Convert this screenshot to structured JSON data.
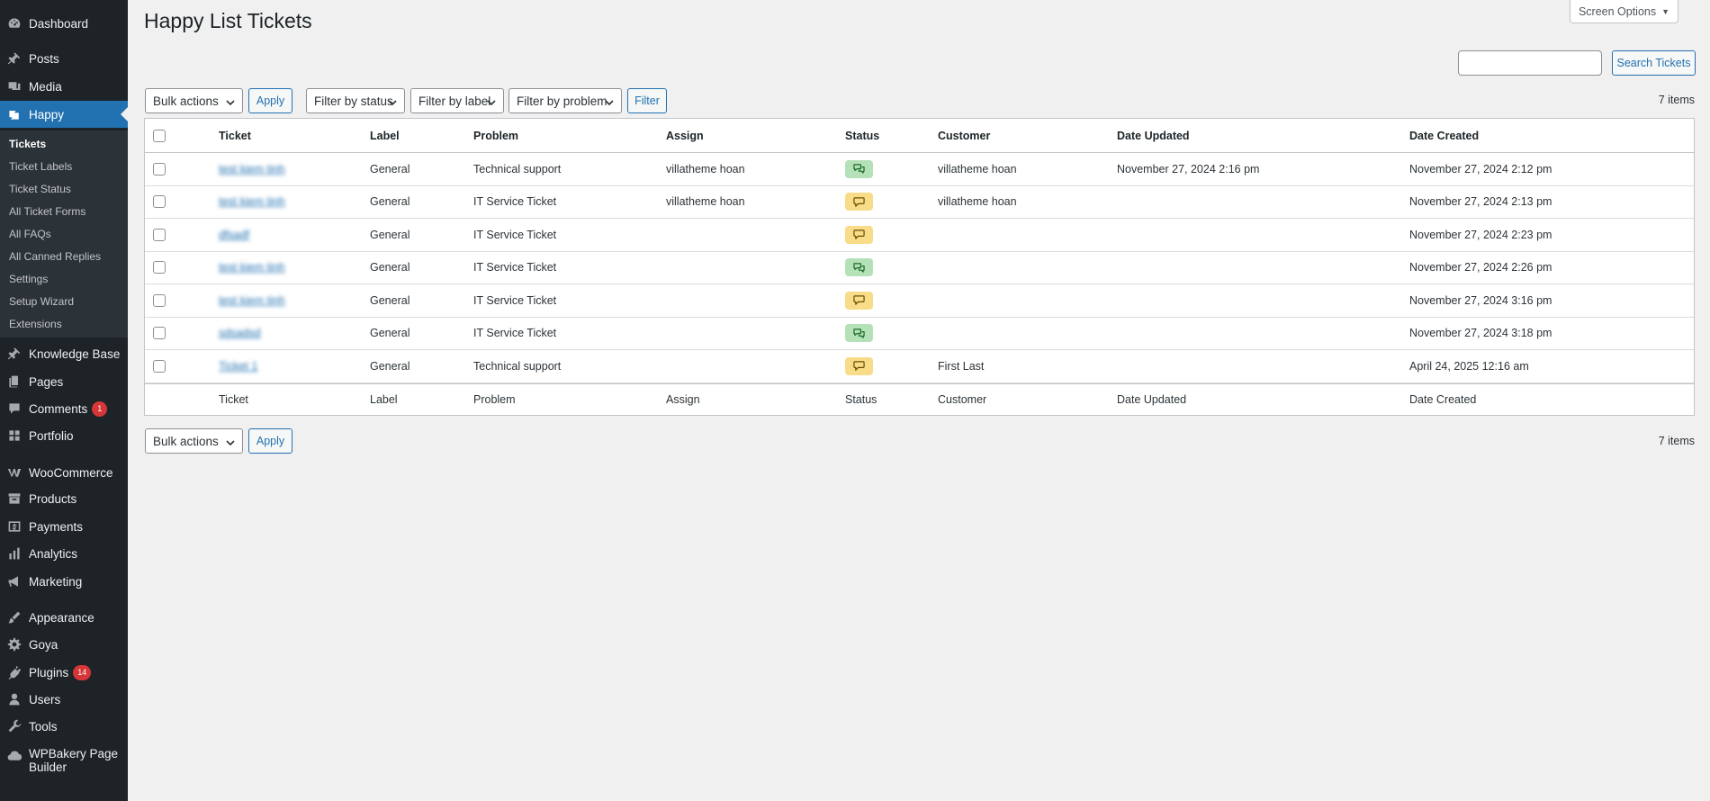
{
  "sidebar": {
    "items": [
      {
        "label": "Dashboard",
        "icon": "dashboard-icon"
      },
      {
        "label": "Posts",
        "icon": "pin-icon"
      },
      {
        "label": "Media",
        "icon": "media-icon"
      },
      {
        "label": "Happy",
        "icon": "happy-icon"
      },
      {
        "label": "Knowledge Base",
        "icon": "pin-icon"
      },
      {
        "label": "Pages",
        "icon": "pages-icon"
      },
      {
        "label": "Comments",
        "icon": "comment-icon",
        "badge": "1"
      },
      {
        "label": "Portfolio",
        "icon": "portfolio-icon"
      },
      {
        "label": "WooCommerce",
        "icon": "woocommerce-icon"
      },
      {
        "label": "Products",
        "icon": "archive-icon"
      },
      {
        "label": "Payments",
        "icon": "dollar-icon"
      },
      {
        "label": "Analytics",
        "icon": "bar-chart-icon"
      },
      {
        "label": "Marketing",
        "icon": "megaphone-icon"
      },
      {
        "label": "Appearance",
        "icon": "brush-icon"
      },
      {
        "label": "Goya",
        "icon": "gear-icon"
      },
      {
        "label": "Plugins",
        "icon": "plugin-icon",
        "badge": "14"
      },
      {
        "label": "Users",
        "icon": "user-icon"
      },
      {
        "label": "Tools",
        "icon": "wrench-icon"
      },
      {
        "label": "WPBakery Page Builder",
        "icon": "cloud-icon"
      }
    ],
    "submenu": [
      "Tickets",
      "Ticket Labels",
      "Ticket Status",
      "All Ticket Forms",
      "All FAQs",
      "All Canned Replies",
      "Settings",
      "Setup Wizard",
      "Extensions"
    ]
  },
  "header": {
    "title": "Happy List Tickets",
    "screen_options": "Screen Options"
  },
  "search": {
    "button": "Search Tickets",
    "value": ""
  },
  "toolbar": {
    "bulk_actions": "Bulk actions",
    "apply": "Apply",
    "filter_status": "Filter by status",
    "filter_label": "Filter by label",
    "filter_problem": "Filter by problem",
    "filter": "Filter",
    "items_count": "7 items"
  },
  "table": {
    "columns": [
      "Ticket",
      "Label",
      "Problem",
      "Assign",
      "Status",
      "Customer",
      "Date Updated",
      "Date Created"
    ],
    "rows": [
      {
        "ticket": "test kiem tinh",
        "label": "General",
        "problem": "Technical support",
        "assign": "villatheme hoan",
        "status": "green",
        "customer": "villatheme hoan",
        "updated": "November 27, 2024 2:16 pm",
        "created": "November 27, 2024 2:12 pm"
      },
      {
        "ticket": "test kiem tinh",
        "label": "General",
        "problem": "IT Service Ticket",
        "assign": "villatheme hoan",
        "status": "yellow",
        "customer": "villatheme hoan",
        "updated": "",
        "created": "November 27, 2024 2:13 pm"
      },
      {
        "ticket": "dfsadf",
        "label": "General",
        "problem": "IT Service Ticket",
        "assign": "",
        "status": "yellow",
        "customer": "",
        "updated": "",
        "created": "November 27, 2024 2:23 pm"
      },
      {
        "ticket": "test kiem tinh",
        "label": "General",
        "problem": "IT Service Ticket",
        "assign": "",
        "status": "green",
        "customer": "",
        "updated": "",
        "created": "November 27, 2024 2:26 pm"
      },
      {
        "ticket": "test kiem tinh",
        "label": "General",
        "problem": "IT Service Ticket",
        "assign": "",
        "status": "yellow",
        "customer": "",
        "updated": "",
        "created": "November 27, 2024 3:16 pm"
      },
      {
        "ticket": "sdsadsd",
        "label": "General",
        "problem": "IT Service Ticket",
        "assign": "",
        "status": "green",
        "customer": "",
        "updated": "",
        "created": "November 27, 2024 3:18 pm"
      },
      {
        "ticket": "Ticket 1",
        "label": "General",
        "problem": "Technical support",
        "assign": "",
        "status": "yellow",
        "customer": "First Last",
        "updated": "",
        "created": "April 24, 2025 12:16 am"
      }
    ]
  },
  "colors": {
    "sidebar_bg": "#1d2327",
    "submenu_bg": "#2c3338",
    "accent": "#2271b1",
    "status_green": "#b5e1b9",
    "status_yellow": "#f8dc87",
    "badge_red": "#d63638"
  }
}
